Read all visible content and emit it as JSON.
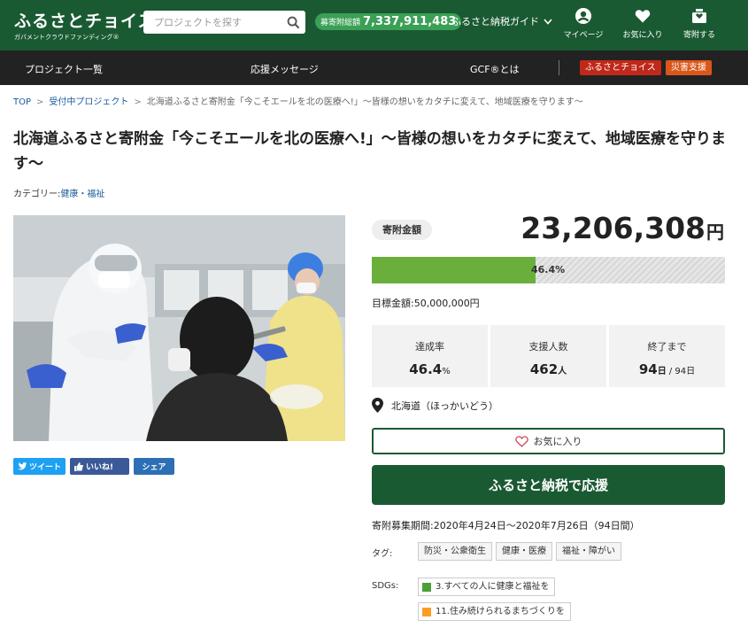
{
  "header": {
    "logo_main": "ふるさとチョイス",
    "logo_sub": "ガバメントクラウドファンディング®",
    "search_placeholder": "プロジェクトを探す",
    "total_label": "募寄附総額",
    "total_value": "7,337,911,483",
    "guide_label": "ふるさと納税ガイド",
    "nav": {
      "mypage": "マイページ",
      "favorites": "お気に入り",
      "donate": "寄附する"
    }
  },
  "gnav": {
    "projects": "プロジェクト一覧",
    "messages": "応援メッセージ",
    "about": "GCF®とは",
    "choice": "ふるさとチョイス",
    "disaster": "災害支援"
  },
  "breadcrumb": {
    "top": "TOP",
    "accepting": "受付中プロジェクト",
    "current": "北海道ふるさと寄附金「今こそエールを北の医療へ!」〜皆様の想いをカタチに変えて、地域医療を守ります〜"
  },
  "project": {
    "title": "北海道ふるさと寄附金「今こそエールを北の医療へ!」〜皆様の想いをカタチに変えて、地域医療を守ります〜",
    "category_label": "カテゴリー:",
    "category": "健康・福祉"
  },
  "share": {
    "tweet": "ツイート",
    "like": "いいね!",
    "share": "シェア"
  },
  "funding": {
    "amount_label": "寄附金額",
    "amount": "23,206,308",
    "amount_unit": "円",
    "progress_percent": 46.4,
    "progress_text": "46.4%",
    "goal_text": "目標金額:50,000,000円",
    "stats": {
      "rate_label": "達成率",
      "rate_value": "46.4",
      "rate_unit": "%",
      "supporters_label": "支援人数",
      "supporters_value": "462",
      "supporters_unit": "人",
      "remaining_label": "終了まで",
      "remaining_value": "94",
      "remaining_unit": "日",
      "remaining_total": " / 94日"
    },
    "location": "北海道（ほっかいどう）",
    "favorite_button": "お気に入り",
    "donate_button": "ふるさと納税で応援",
    "period": "寄附募集期間:2020年4月24日〜2020年7月26日（94日間）",
    "tags_label": "タグ:",
    "tags": [
      "防災・公衆衛生",
      "健康・医療",
      "福祉・障がい"
    ],
    "sdgs_label": "SDGs:",
    "sdgs": [
      {
        "label": "3.すべての人に健康と福祉を",
        "color": "#4c9f38"
      },
      {
        "label": "11.住み続けられるまちづくりを",
        "color": "#fd9d24"
      }
    ]
  },
  "colors": {
    "brand_green": "#1a5a33",
    "progress_green": "#6aaf3c",
    "badge_red": "#c0281a",
    "badge_orange": "#d9571a"
  }
}
